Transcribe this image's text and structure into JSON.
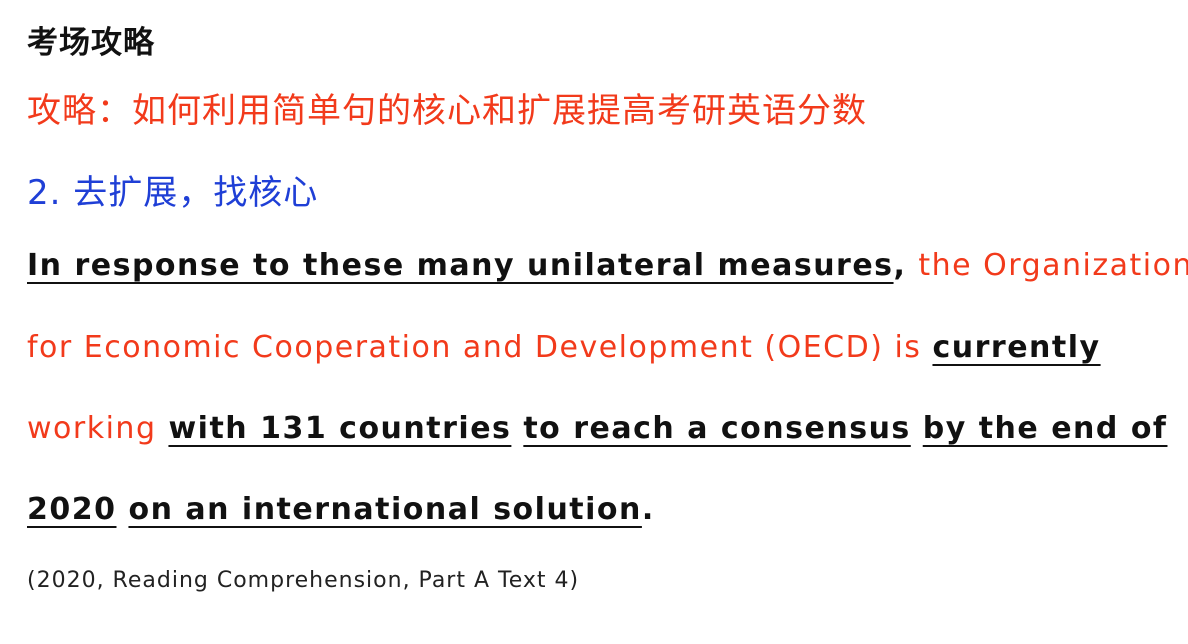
{
  "title": "考场攻略",
  "strategy_heading": "攻略：如何利用简单句的核心和扩展提高考研英语分数",
  "step_heading": "2. 去扩展，找核心",
  "sentence": {
    "line1": {
      "phrase_in_response": "In response to these many unilateral measures",
      "comma": ", ",
      "subject_part1": "the Organization"
    },
    "line2": {
      "subject_part2": "for Economic Cooperation and Development (OECD) is ",
      "adverb_currently": "currently"
    },
    "line3": {
      "verb_working": "working",
      "space": " ",
      "phrase_with": "with 131 countries",
      "phrase_to_reach": "to reach a consensus",
      "phrase_by_end": "by the end of"
    },
    "line4": {
      "year": "2020",
      "phrase_on": "on an international solution",
      "period": "."
    }
  },
  "citation": "(2020, Reading Comprehension, Part A Text 4)"
}
